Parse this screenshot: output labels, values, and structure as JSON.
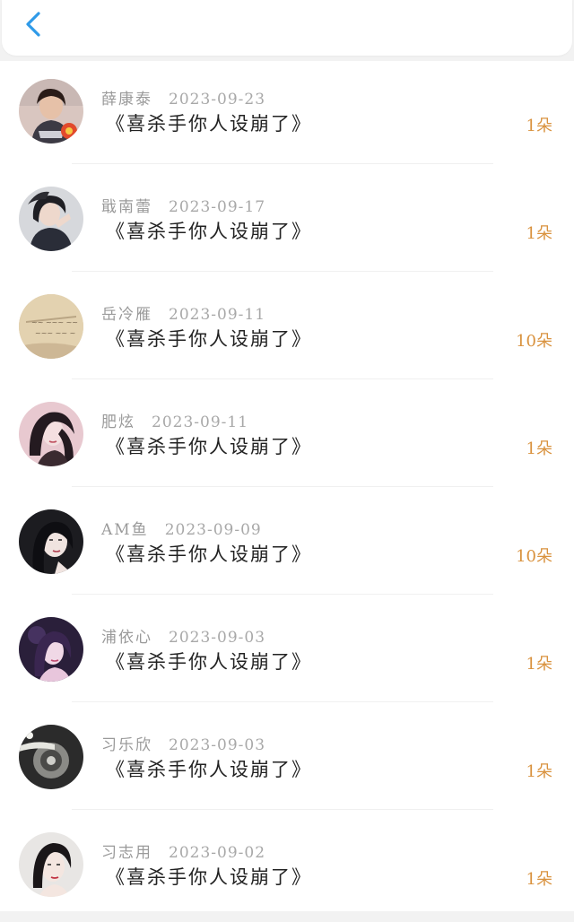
{
  "header": {
    "back_icon": "chevron-left-icon",
    "accent": "#2f9ae8"
  },
  "gifts": [
    {
      "name": "薛康泰",
      "date": "2023-09-23",
      "title": "《喜杀手你人设崩了》",
      "count": "1朵"
    },
    {
      "name": "戢南蕾",
      "date": "2023-09-17",
      "title": "《喜杀手你人设崩了》",
      "count": "1朵"
    },
    {
      "name": "岳冷雁",
      "date": "2023-09-11",
      "title": "《喜杀手你人设崩了》",
      "count": "10朵"
    },
    {
      "name": "肥炫",
      "date": "2023-09-11",
      "title": "《喜杀手你人设崩了》",
      "count": "1朵"
    },
    {
      "name": "AM鱼",
      "date": "2023-09-09",
      "title": "《喜杀手你人设崩了》",
      "count": "10朵"
    },
    {
      "name": "浦依心",
      "date": "2023-09-03",
      "title": "《喜杀手你人设崩了》",
      "count": "1朵"
    },
    {
      "name": "习乐欣",
      "date": "2023-09-03",
      "title": "《喜杀手你人设崩了》",
      "count": "1朵"
    },
    {
      "name": "习志用",
      "date": "2023-09-02",
      "title": "《喜杀手你人设崩了》",
      "count": "1朵"
    }
  ],
  "colors": {
    "count": "#d9923e",
    "name": "#9a9a9a",
    "title": "#222222"
  }
}
